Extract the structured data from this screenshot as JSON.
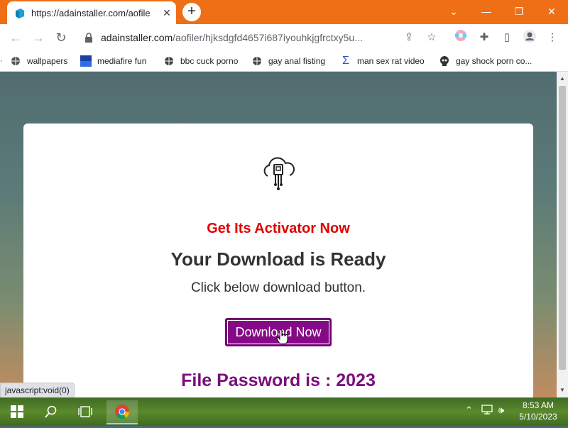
{
  "browser": {
    "tab_title": "https://adainstaller.com/aofile",
    "tab_close": "✕",
    "new_tab": "+",
    "window_controls": {
      "minimize": "—",
      "restore": "❐",
      "close": "✕",
      "tab_search": "⌄"
    },
    "url_domain": "adainstaller.com",
    "url_path": "/aofiler/hjksdgfd4657i687iyouhkjgfrctxy5u...",
    "icons": [
      "back-icon",
      "forward-icon",
      "reload-icon",
      "lock-icon",
      "share-icon",
      "star-icon",
      "extension-icon",
      "puzzle-icon",
      "sidepanel-icon",
      "profile-icon",
      "menu-icon"
    ]
  },
  "bookmarks": [
    {
      "label": "wallpapers",
      "icon": "globe-icon"
    },
    {
      "label": "mediafire fun",
      "icon": "mft-icon"
    },
    {
      "label": "bbc cuck porno",
      "icon": "globe-icon"
    },
    {
      "label": "gay anal fisting",
      "icon": "globe-icon"
    },
    {
      "label": "man sex rat video",
      "icon": "sigma-icon"
    },
    {
      "label": "gay shock porn co...",
      "icon": "skull-icon"
    }
  ],
  "card": {
    "activator_text": "Get Its Activator Now",
    "heading": "Your Download is Ready",
    "subtext": "Click below download button.",
    "button_label": "Download Now",
    "password_text": "File Password is : 2023"
  },
  "status_bar": "javascript:void(0)",
  "taskbar": {
    "time": "8:53 AM",
    "date": "5/10/2023"
  },
  "colors": {
    "chrome_frame": "#ef6f16",
    "activator": "#e00000",
    "button_bg": "#850a87",
    "password": "#7a0e7a"
  }
}
